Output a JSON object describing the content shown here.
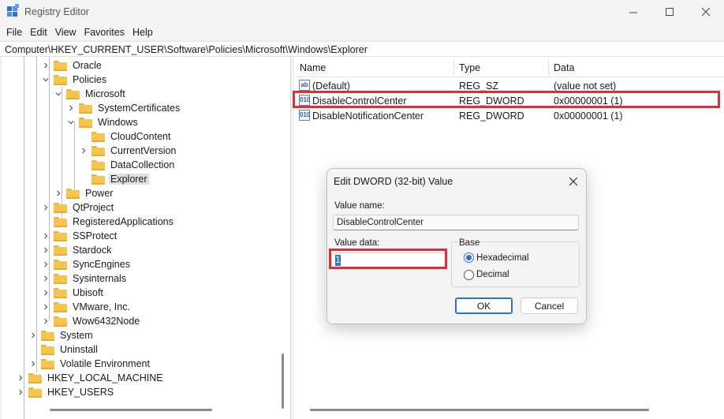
{
  "window": {
    "title": "Registry Editor"
  },
  "menu": [
    "File",
    "Edit",
    "View",
    "Favorites",
    "Help"
  ],
  "address": "Computer\\HKEY_CURRENT_USER\\Software\\Policies\\Microsoft\\Windows\\Explorer",
  "tree": [
    {
      "label": "Oracle",
      "level": 2,
      "state": "collapsed"
    },
    {
      "label": "Policies",
      "level": 2,
      "state": "expanded"
    },
    {
      "label": "Microsoft",
      "level": 3,
      "state": "expanded"
    },
    {
      "label": "SystemCertificates",
      "level": 4,
      "state": "collapsed"
    },
    {
      "label": "Windows",
      "level": 4,
      "state": "expanded"
    },
    {
      "label": "CloudContent",
      "level": 5,
      "state": "none"
    },
    {
      "label": "CurrentVersion",
      "level": 5,
      "state": "collapsed"
    },
    {
      "label": "DataCollection",
      "level": 5,
      "state": "none"
    },
    {
      "label": "Explorer",
      "level": 5,
      "state": "none",
      "selected": true
    },
    {
      "label": "Power",
      "level": 3,
      "state": "collapsed"
    },
    {
      "label": "QtProject",
      "level": 2,
      "state": "collapsed"
    },
    {
      "label": "RegisteredApplications",
      "level": 2,
      "state": "none"
    },
    {
      "label": "SSProtect",
      "level": 2,
      "state": "collapsed"
    },
    {
      "label": "Stardock",
      "level": 2,
      "state": "collapsed"
    },
    {
      "label": "SyncEngines",
      "level": 2,
      "state": "collapsed"
    },
    {
      "label": "Sysinternals",
      "level": 2,
      "state": "collapsed"
    },
    {
      "label": "Ubisoft",
      "level": 2,
      "state": "collapsed"
    },
    {
      "label": "VMware, Inc.",
      "level": 2,
      "state": "collapsed"
    },
    {
      "label": "Wow6432Node",
      "level": 2,
      "state": "collapsed"
    },
    {
      "label": "System",
      "level": 1,
      "state": "collapsed"
    },
    {
      "label": "Uninstall",
      "level": 1,
      "state": "none"
    },
    {
      "label": "Volatile Environment",
      "level": 1,
      "state": "collapsed"
    },
    {
      "label": "HKEY_LOCAL_MACHINE",
      "level": 0,
      "state": "collapsed"
    },
    {
      "label": "HKEY_USERS",
      "level": 0,
      "state": "collapsed"
    }
  ],
  "list": {
    "columns": {
      "name": "Name",
      "type": "Type",
      "data": "Data"
    },
    "rows": [
      {
        "icon": "string-value-icon",
        "icon_glyph": "ab",
        "name": "(Default)",
        "type": "REG_SZ",
        "data": "(value not set)"
      },
      {
        "icon": "binary-value-icon",
        "icon_glyph": "010",
        "name": "DisableControlCenter",
        "type": "REG_DWORD",
        "data": "0x00000001 (1)",
        "highlighted": true
      },
      {
        "icon": "binary-value-icon",
        "icon_glyph": "010",
        "name": "DisableNotificationCenter",
        "type": "REG_DWORD",
        "data": "0x00000001 (1)"
      }
    ]
  },
  "dialog": {
    "title": "Edit DWORD (32-bit) Value",
    "value_name_label": "Value name:",
    "value_name": "DisableControlCenter",
    "value_data_label": "Value data:",
    "value_data": "1",
    "base_label": "Base",
    "base_options": [
      "Hexadecimal",
      "Decimal"
    ],
    "base_selected": "Hexadecimal",
    "ok_label": "OK",
    "cancel_label": "Cancel"
  },
  "colors": {
    "highlight_border": "#d9303a",
    "accent": "#2f6fcf",
    "folder": "#f5c54f"
  }
}
